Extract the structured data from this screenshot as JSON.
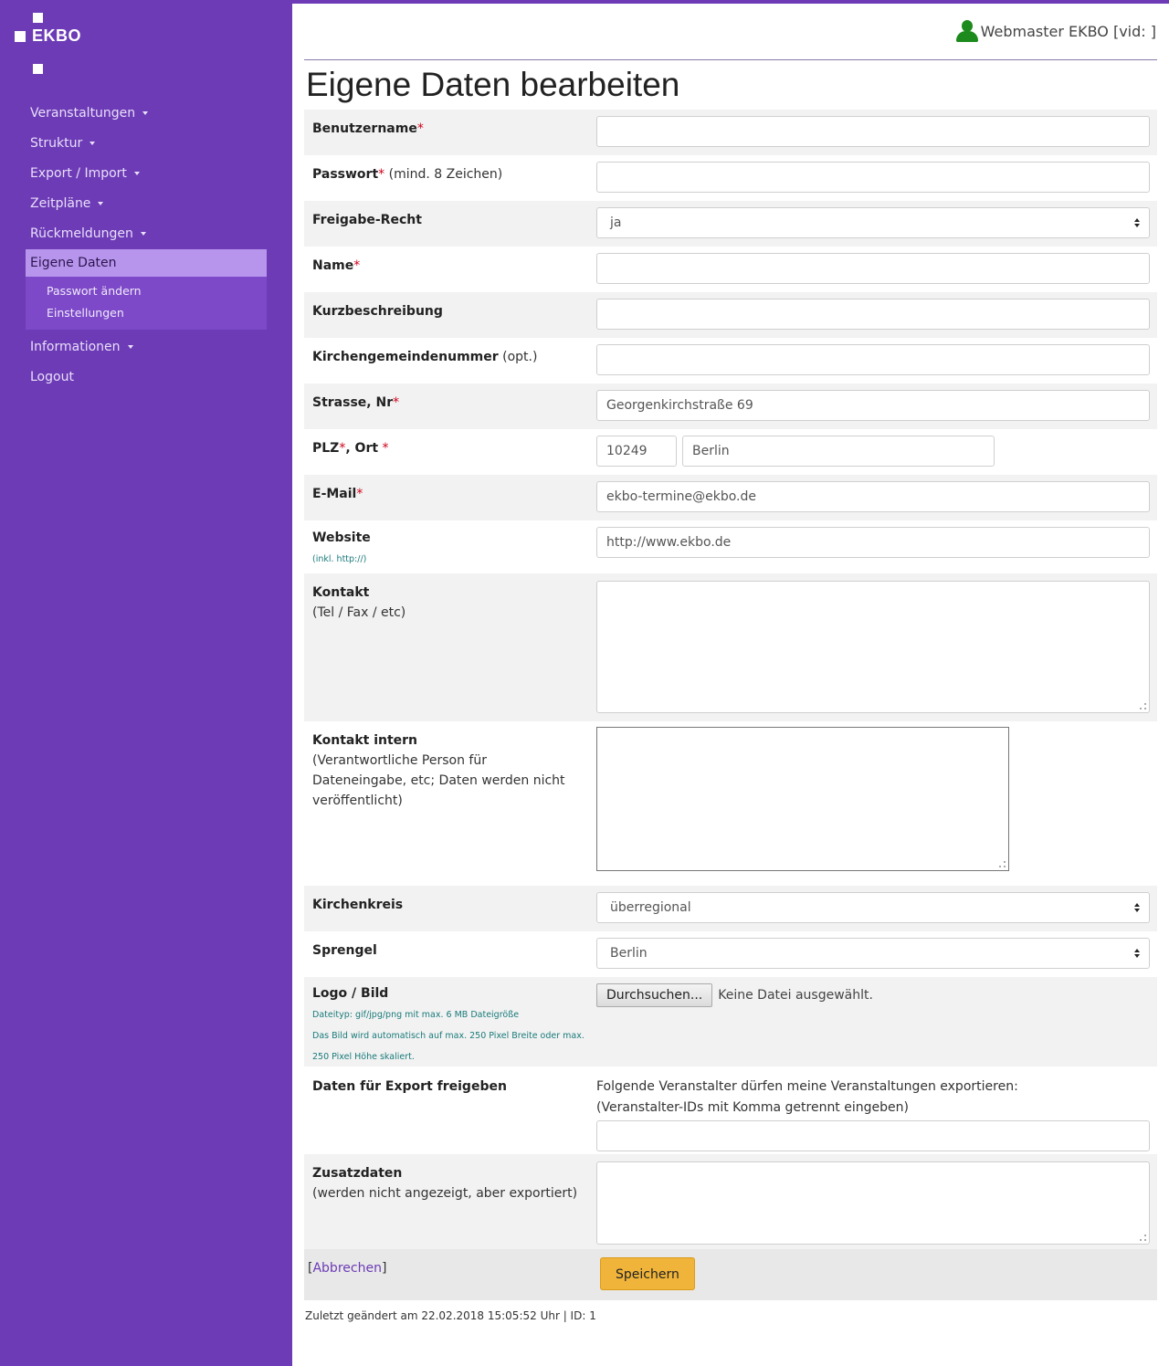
{
  "sidebar": {
    "logo": "EKBO",
    "items": [
      {
        "label": "Veranstaltungen",
        "caret": true
      },
      {
        "label": "Struktur",
        "caret": true
      },
      {
        "label": "Export / Import",
        "caret": true
      },
      {
        "label": "Zeitpläne",
        "caret": true
      },
      {
        "label": "Rückmeldungen",
        "caret": true
      },
      {
        "label": "Eigene Daten",
        "active": true
      },
      {
        "label": "Informationen",
        "caret": true
      },
      {
        "label": "Logout"
      }
    ],
    "subitems": [
      "Passwort ändern",
      "Einstellungen"
    ]
  },
  "header": {
    "user": "Webmaster EKBO [vid:  ]",
    "user_icon": "user-icon",
    "title": "Eigene Daten bearbeiten"
  },
  "form": {
    "username": {
      "label": "Benutzername",
      "value": ""
    },
    "password": {
      "label": "Passwort",
      "note": "(mind. 8 Zeichen)",
      "value": ""
    },
    "freigabe": {
      "label": "Freigabe-Recht",
      "value": "ja"
    },
    "name": {
      "label": "Name",
      "value": ""
    },
    "kurz": {
      "label": "Kurzbeschreibung",
      "value": ""
    },
    "kgnr": {
      "label": "Kirchengemeindenummer",
      "note": "(opt.)",
      "value": ""
    },
    "strasse": {
      "label": "Strasse, Nr",
      "value": "Georgenkirchstraße 69"
    },
    "plz": {
      "label_plz": "PLZ",
      "label_ort": ", Ort",
      "plz": "10249",
      "ort": "Berlin"
    },
    "email": {
      "label": "E-Mail",
      "value": "ekbo-termine@ekbo.de"
    },
    "website": {
      "label": "Website",
      "hint": "(inkl. http://)",
      "value": "http://www.ekbo.de"
    },
    "kontakt": {
      "label": "Kontakt",
      "note": "(Tel / Fax / etc)"
    },
    "kontakt_intern": {
      "label": "Kontakt intern",
      "note": "(Verantwortliche Person für Dateneingabe, etc; Daten werden nicht veröffentlicht)"
    },
    "kirchenkreis": {
      "label": "Kirchenkreis",
      "value": "überregional"
    },
    "sprengel": {
      "label": "Sprengel",
      "value": "Berlin"
    },
    "logo": {
      "label": "Logo / Bild",
      "hint1": "Dateityp: gif/jpg/png mit max. 6 MB Dateigröße",
      "hint2": "Das Bild wird automatisch auf max. 250 Pixel Breite oder max. 250 Pixel Höhe skaliert.",
      "button": "Durchsuchen...",
      "status": "Keine Datei ausgewählt."
    },
    "export": {
      "label": "Daten für Export freigeben",
      "text1": "Folgende Veranstalter dürfen meine Veranstaltungen exportieren:",
      "text2": "(Veranstalter-IDs mit Komma getrennt eingeben)",
      "value": ""
    },
    "zusatz": {
      "label": "Zusatzdaten",
      "note": "(werden nicht angezeigt, aber exportiert)"
    },
    "cancel_pre": "[",
    "cancel": "Abbrechen",
    "cancel_post": "]",
    "save": "Speichern"
  },
  "footer": "Zuletzt geändert am 22.02.2018 15:05:52 Uhr | ID: 1",
  "colors": {
    "sidebar": "#6c3bb5",
    "active": "#b895ec",
    "save": "#f0b43a",
    "required": "#d0021b"
  }
}
